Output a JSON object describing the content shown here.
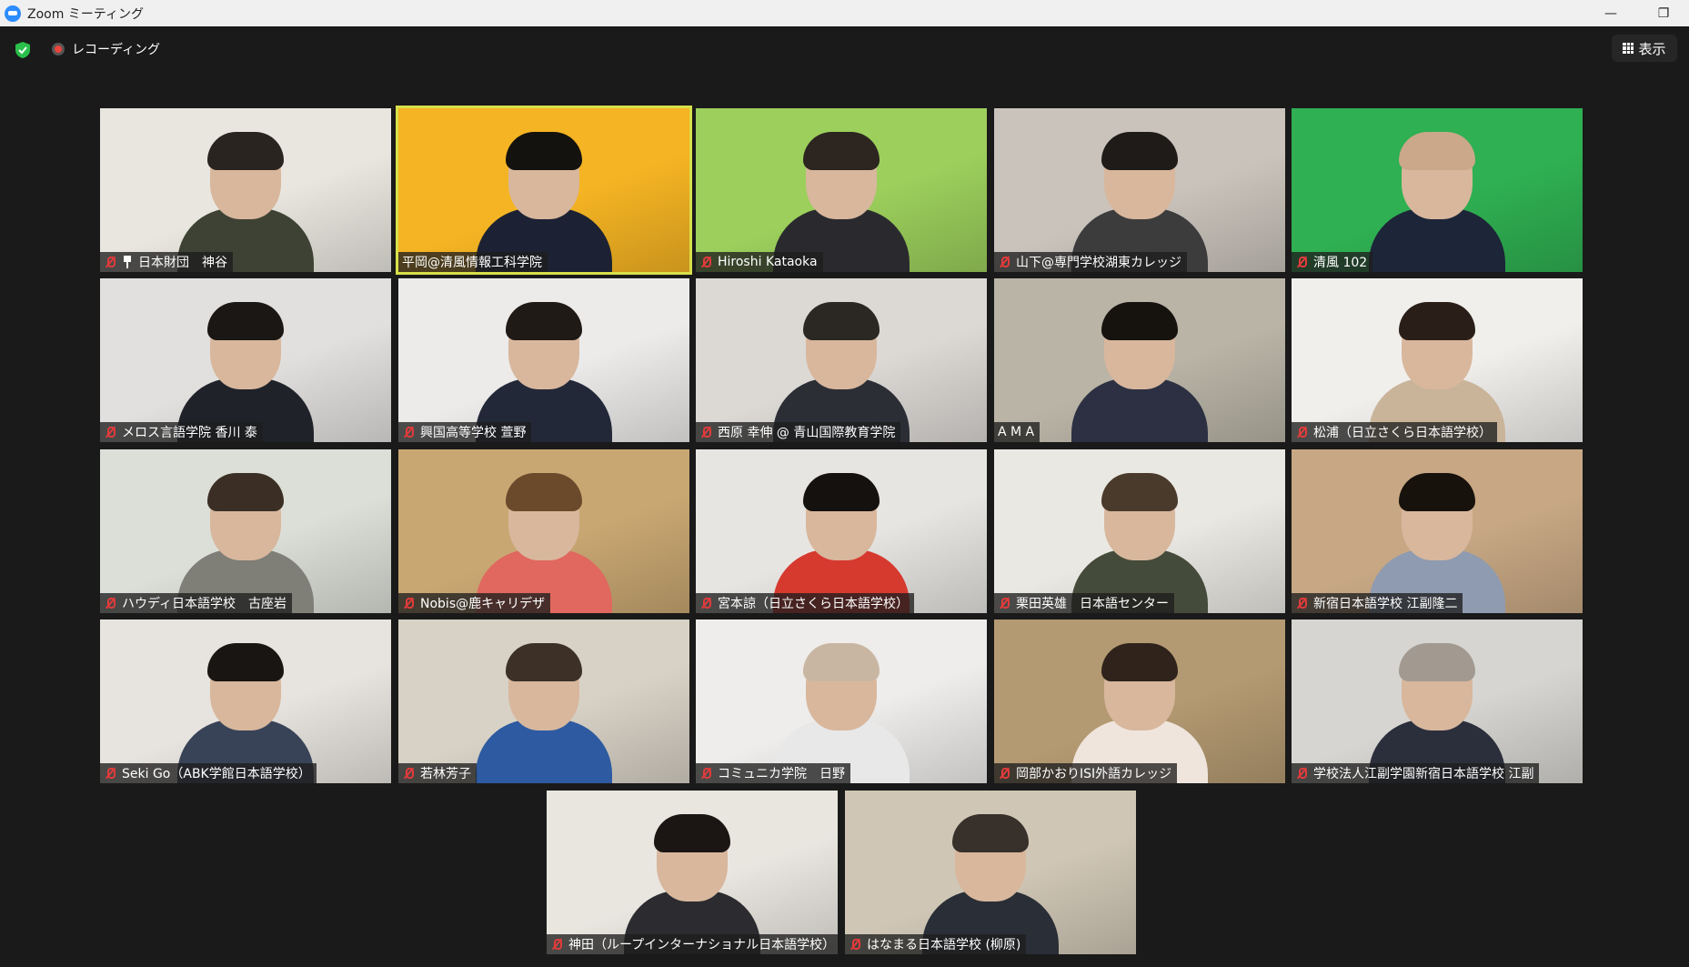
{
  "window": {
    "title": "Zoom ミーティング",
    "minimize": "—",
    "restore": "❐"
  },
  "toolbar": {
    "recording_label": "レコーディング",
    "view_label": "表示"
  },
  "colors": {
    "background": "#1a1a1a",
    "active_speaker": "#d7e04a",
    "muted_mic": "#e23b3b",
    "security_green": "#2bbf4b"
  },
  "participants": [
    {
      "name": "日本財団　神谷",
      "muted": true,
      "pinned": true,
      "bg": "#e9e6df",
      "shirt": "#3e4234",
      "hair": "#2a2420"
    },
    {
      "name": "平岡@清風情報工科学院",
      "muted": false,
      "active": true,
      "bg": "#f5b423",
      "shirt": "#1c2233",
      "hair": "#14120f"
    },
    {
      "name": "Hiroshi Kataoka",
      "muted": true,
      "bg": "#9ccf5c",
      "shirt": "#2a2a2e",
      "hair": "#2c2520"
    },
    {
      "name": "山下@専門学校湖東カレッジ",
      "muted": true,
      "bg": "#c9c3bb",
      "shirt": "#3c3c3c",
      "hair": "#1e1b18"
    },
    {
      "name": "清風 102",
      "muted": true,
      "bg": "#2fb052",
      "shirt": "#1d2538",
      "hair": "#caa889"
    },
    {
      "name": "メロス言語学院 香川 泰",
      "muted": true,
      "bg": "#e2e0de",
      "shirt": "#1f2229",
      "hair": "#1a1714"
    },
    {
      "name": "興国高等学校 萱野",
      "muted": true,
      "bg": "#ecebea",
      "shirt": "#232838",
      "hair": "#1f1a16"
    },
    {
      "name": "西原 幸伸 @ 青山国際教育学院",
      "muted": true,
      "bg": "#dcd9d5",
      "shirt": "#2c2e36",
      "hair": "#2b2824"
    },
    {
      "name": "A M A",
      "muted": false,
      "bg": "#b9b4a6",
      "shirt": "#2c3042",
      "hair": "#16130f"
    },
    {
      "name": "松浦（日立さくら日本語学校）",
      "muted": true,
      "bg": "#f1efec",
      "shirt": "#c9b49a",
      "hair": "#2a1f18"
    },
    {
      "name": "ハウディ日本語学校　古座岩",
      "muted": true,
      "bg": "#dcdfd8",
      "shirt": "#7f7e77",
      "hair": "#3b2f25"
    },
    {
      "name": "Nobis@鹿キャリデザ",
      "muted": true,
      "bg": "#c9a772",
      "shirt": "#e0685e",
      "hair": "#6b4a2c"
    },
    {
      "name": "宮本諒（日立さくら日本語学校）",
      "muted": true,
      "bg": "#e7e5e2",
      "shirt": "#d63a2f",
      "hair": "#14110e"
    },
    {
      "name": "栗田英雄　日本語センター",
      "muted": true,
      "bg": "#eae8e3",
      "shirt": "#454b3a",
      "hair": "#4a3a2c"
    },
    {
      "name": "新宿日本語学校 江副隆二",
      "muted": true,
      "bg": "#c8a884",
      "shirt": "#8f9bb0",
      "hair": "#18120d"
    },
    {
      "name": "Seki Go（ABK学館日本語学校）",
      "muted": true,
      "bg": "#e7e4df",
      "shirt": "#394357",
      "hair": "#191512"
    },
    {
      "name": "若林芳子",
      "muted": true,
      "bg": "#d8d2c6",
      "shirt": "#2d5aa0",
      "hair": "#3c3027"
    },
    {
      "name": "コミュニカ学院　日野",
      "muted": true,
      "bg": "#eeedeb",
      "shirt": "#e8e8e8",
      "hair": "#c9b6a2"
    },
    {
      "name": "岡部かおりISI外語カレッジ",
      "muted": true,
      "bg": "#b49a72",
      "shirt": "#efe5dc",
      "hair": "#2f231c"
    },
    {
      "name": "学校法人江副学園新宿日本語学校 江副",
      "muted": true,
      "bg": "#d6d5d1",
      "shirt": "#2b2f3c",
      "hair": "#a29a91"
    },
    {
      "name": "神田（ループインターナショナル日本語学校）",
      "muted": true,
      "bg": "#e9e6e0",
      "shirt": "#2b2b30",
      "hair": "#1b1613"
    },
    {
      "name": "はなまる日本語学校 (柳原)",
      "muted": true,
      "bg": "#cfc6b5",
      "shirt": "#2a2e36",
      "hair": "#38302a"
    }
  ]
}
